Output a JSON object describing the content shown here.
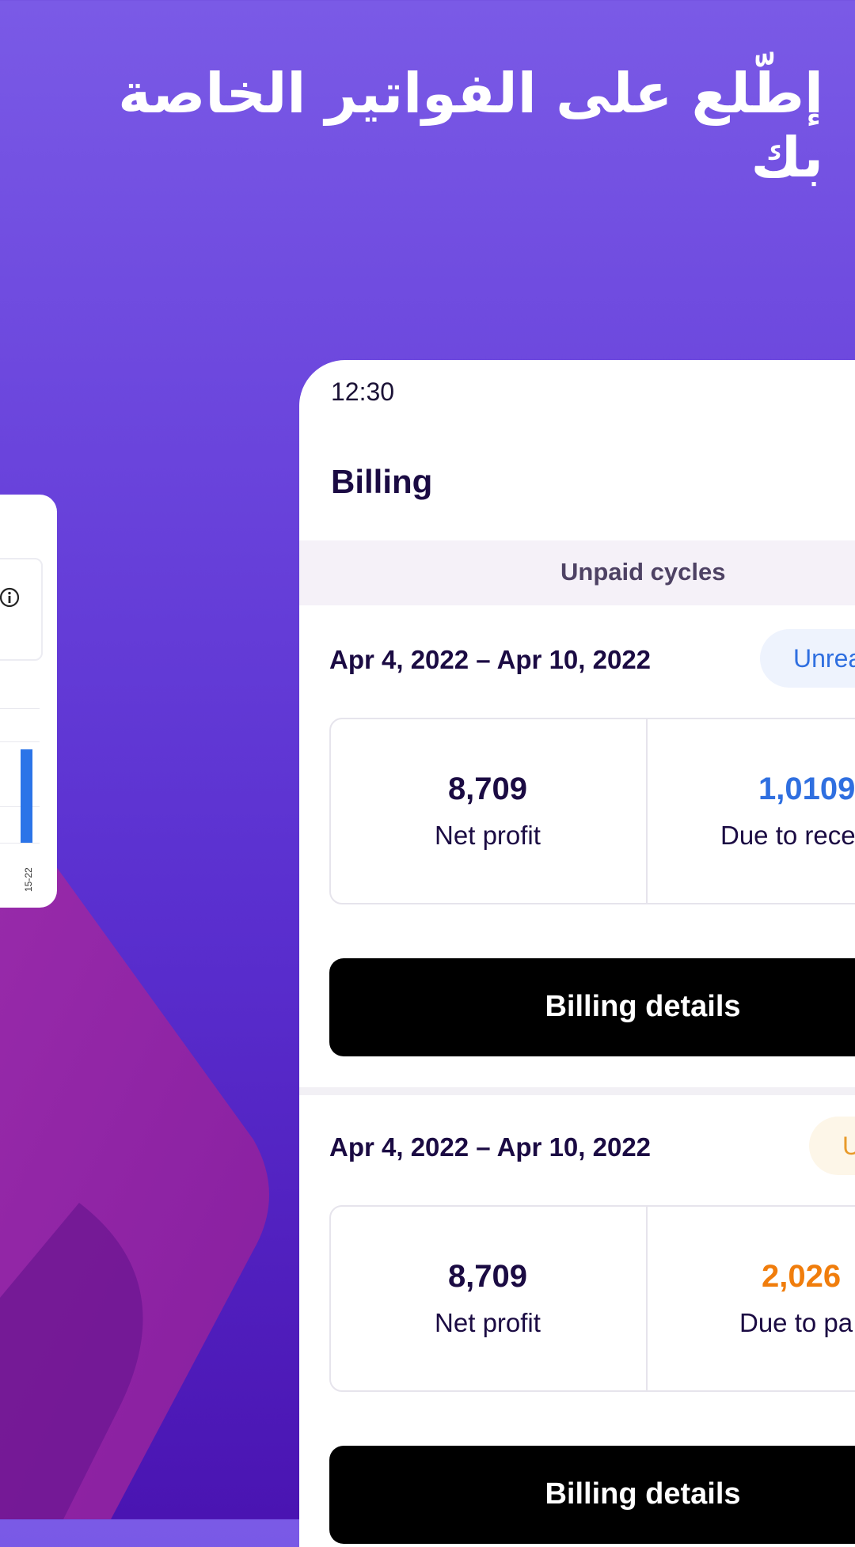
{
  "headline": "إطّلع على الفواتير الخاصة بك",
  "mini_chart": {
    "tick_label": "15-22",
    "bar_color": "#2b74e8",
    "icon": "info-icon"
  },
  "phone": {
    "status_time": "12:30",
    "title": "Billing",
    "tab": "Unpaid cycles",
    "cycles": [
      {
        "date_range": "Apr 4, 2022 – Apr 10, 2022",
        "badge": "Unrea",
        "badge_color": "#2f6fe0",
        "net_profit_value": "8,709",
        "net_profit_label": "Net profit",
        "due_value": "1,0109",
        "due_value_color": "#2f6fe0",
        "due_label": "Due to rece",
        "button": "Billing details"
      },
      {
        "date_range": "Apr 4, 2022 – Apr 10, 2022",
        "badge": "U",
        "badge_color": "#e89a2a",
        "net_profit_value": "8,709",
        "net_profit_label": "Net profit",
        "due_value": "2,026",
        "due_value_color": "#f07d0c",
        "due_label": "Due to pa",
        "button": "Billing details"
      }
    ]
  }
}
